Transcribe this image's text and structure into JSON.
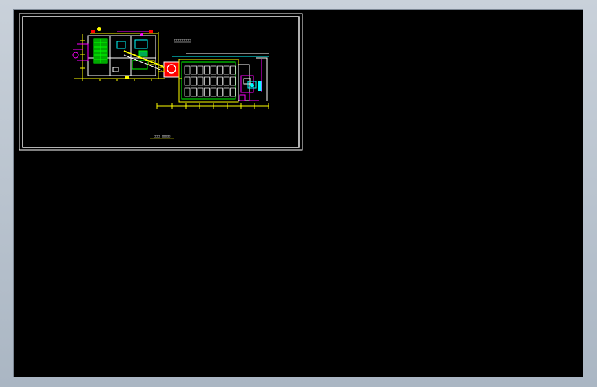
{
  "app": {
    "canvas_background": "#000000",
    "chrome_background": "#b7c2ce"
  },
  "drawing": {
    "title_mark": "□□□□□□□□",
    "plan_caption": "—□□□—□□□□",
    "palette": {
      "frame": "#ffffff",
      "dimension": "#ffff00",
      "walls": "#ffffff",
      "equipment_green": "#00ff00",
      "equipment_cyan": "#00ffff",
      "equipment_magenta": "#ff00ff",
      "equipment_red": "#ff0000",
      "equipment_blue": "#3b6bff"
    }
  }
}
